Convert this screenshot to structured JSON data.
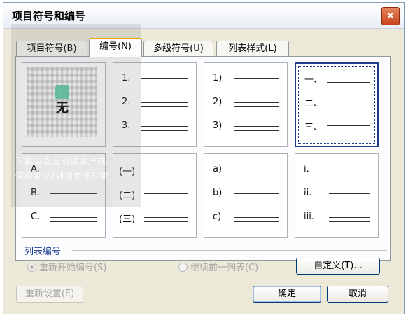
{
  "window": {
    "title": "项目符号和编号",
    "close_label": "×"
  },
  "tabs": [
    {
      "label": "项目符号(B)"
    },
    {
      "label": "编号(N)"
    },
    {
      "label": "多级符号(U)"
    },
    {
      "label": "列表样式(L)"
    }
  ],
  "gallery": {
    "none_label": "无",
    "cells": [
      {
        "markers": [
          "1.",
          "2.",
          "3."
        ]
      },
      {
        "markers": [
          "1)",
          "2)",
          "3)"
        ]
      },
      {
        "markers": [
          "一、",
          "二、",
          "三、"
        ]
      },
      {
        "markers": [
          "A.",
          "B.",
          "C."
        ]
      },
      {
        "markers": [
          "(一)",
          "(二)",
          "(三)"
        ]
      },
      {
        "markers": [
          "a)",
          "b)",
          "c)"
        ]
      },
      {
        "markers": [
          "i.",
          "ii.",
          "iii."
        ]
      }
    ]
  },
  "overlay": {
    "line1": "下载当当云阅读客户端",
    "line2": "使用笔记/划线更多功能"
  },
  "list_numbering": {
    "label": "列表编号",
    "restart_label": "重新开始编号(S)",
    "continue_label": "继续前一列表(C)"
  },
  "buttons": {
    "customize": "自定义(T)...",
    "reset": "重新设置(E)",
    "ok": "确定",
    "cancel": "取消"
  }
}
